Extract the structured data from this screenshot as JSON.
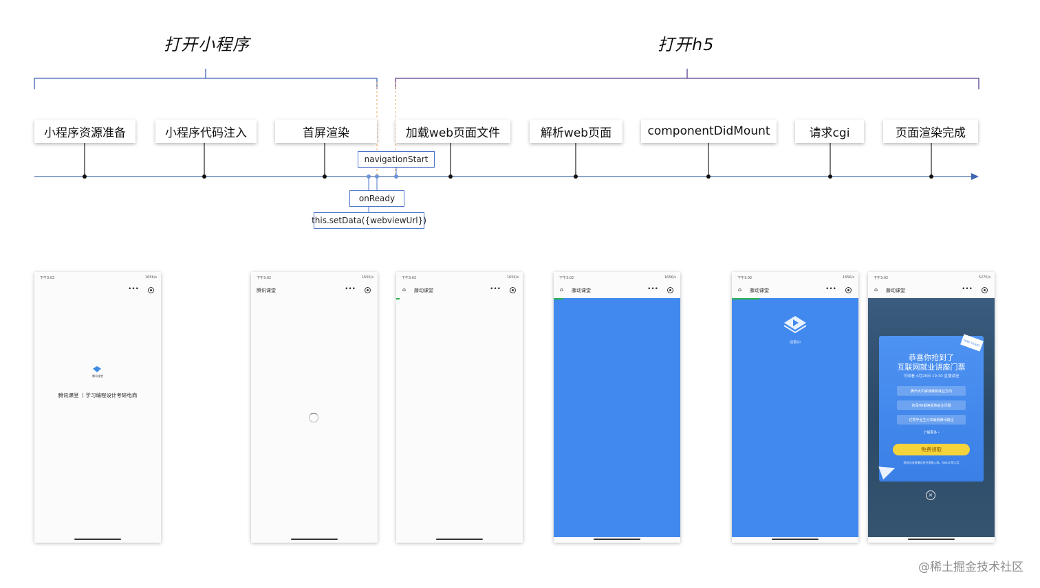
{
  "phases": [
    {
      "title": "打开小程序"
    },
    {
      "title": "打开h5"
    }
  ],
  "steps": [
    "小程序资源准备",
    "小程序代码注入",
    "首屏渲染",
    "加载web页面文件",
    "解析web页面",
    "componentDidMount",
    "请求cgi",
    "页面渲染完成"
  ],
  "events": {
    "navigation_start": "navigationStart",
    "on_ready": "onReady",
    "set_data": "this.setData({webviewUrl})"
  },
  "phones": {
    "status_time": "下午3:02",
    "status_right": "165K/s",
    "status_right_last": "527K/s",
    "app_name": "腾讯课堂",
    "app_name_alt": "藤动课堂",
    "splash_logo_text": "腾讯课堂",
    "splash_text": "腾讯课堂 丨学习编程设计考研电商",
    "loading_text": "加载中",
    "promo": {
      "corner": "FREE TICKET",
      "title_line1": "恭喜你抢到了",
      "title_line2": "互联网就业讲座门票",
      "date_line": "可收看 4月28日 19:30 直播讲座",
      "items": [
        "腾讯大牛解读最新就业方向",
        "资深HR解答最热就业问题",
        "优秀毕业生分享最新腾讯路径"
      ],
      "more": "了解更多 ›",
      "button": "免费领取",
      "footer": "提前完成直播信息并提醒入群。Switch等大奖"
    }
  },
  "watermark": "@稀土掘金技术社区",
  "colors": {
    "timeline": "#4a6ea8",
    "bracket_left": "#3d65b3",
    "bracket_right": "#5b3e8e",
    "marker": "#f0a860",
    "phone_blue": "#4289ef",
    "note_border": "#4a74c9"
  }
}
